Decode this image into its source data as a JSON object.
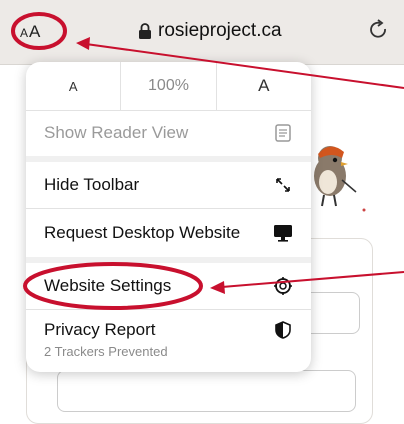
{
  "toolbar": {
    "aa_small": "A",
    "aa_big": "A",
    "url": "rosieproject.ca"
  },
  "menu": {
    "zoom": {
      "decrease_label": "A",
      "percent": "100%",
      "increase_label": "A"
    },
    "items": [
      {
        "label": "Show Reader View",
        "icon": "reader-view-icon",
        "enabled": false
      },
      {
        "label": "Hide Toolbar",
        "icon": "resize-arrows-icon"
      },
      {
        "label": "Request Desktop Website",
        "icon": "desktop-icon"
      },
      {
        "label": "Website Settings",
        "icon": "settings-gear-icon"
      },
      {
        "label": "Privacy Report",
        "sublabel": "2 Trackers Prevented",
        "icon": "privacy-shield-icon"
      }
    ]
  },
  "colors": {
    "annotation": "#c8102e",
    "toolbar_bg": "#edeae7",
    "muted_text": "#9a9a9a"
  }
}
